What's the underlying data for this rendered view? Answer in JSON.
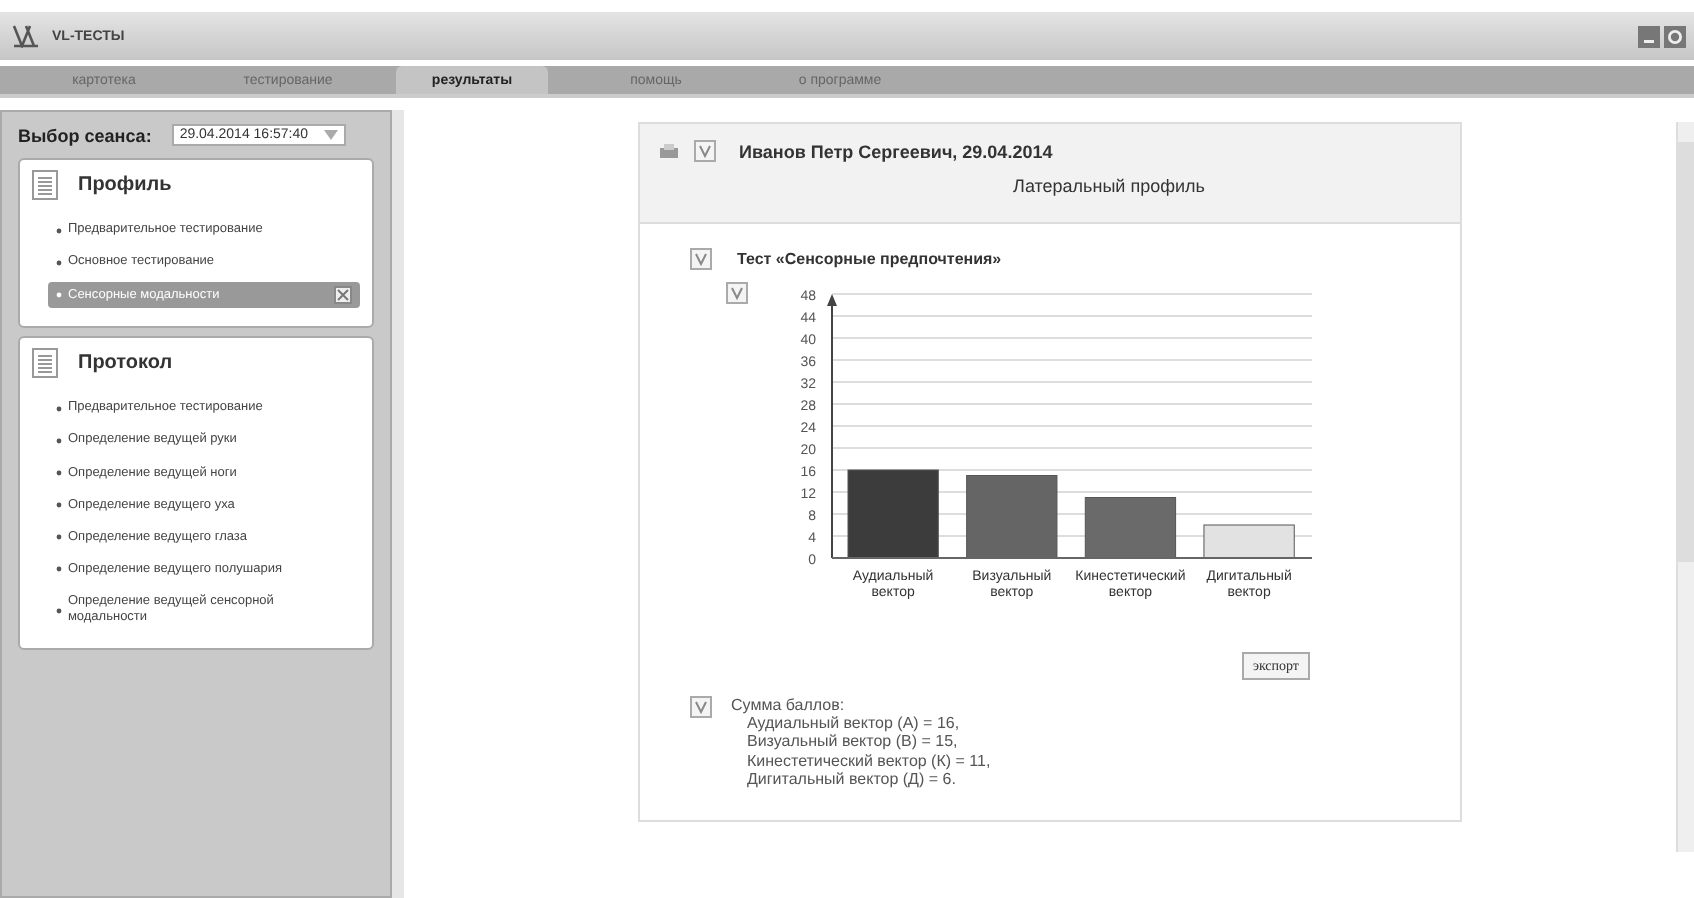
{
  "window": {
    "title": "VL-ТЕСТЫ"
  },
  "tabs": [
    {
      "label": "картотека",
      "selected": false
    },
    {
      "label": "тестирование",
      "selected": false
    },
    {
      "label": "результаты",
      "selected": true
    },
    {
      "label": "помощь",
      "selected": false
    },
    {
      "label": "о программе",
      "selected": false
    }
  ],
  "sidebar": {
    "session_label": "Выбор сеанса:",
    "session_value": "29.04.2014 16:57:40",
    "sections": [
      {
        "title": "Профиль",
        "items": [
          {
            "label": "Предварительное тестирование",
            "selected": false
          },
          {
            "label": "Основное тестирование",
            "selected": false
          },
          {
            "label": "Сенсорные модальности",
            "selected": true
          }
        ]
      },
      {
        "title": "Протокол",
        "items": [
          {
            "label": "Предварительное тестирование",
            "selected": false
          },
          {
            "label": "Определение ведущей руки",
            "selected": false
          },
          {
            "label": "Определение ведущей ноги",
            "selected": false
          },
          {
            "label": "Определение ведущего уха",
            "selected": false
          },
          {
            "label": "Определение ведущего глаза",
            "selected": false
          },
          {
            "label": "Определение ведущего полушария",
            "selected": false
          },
          {
            "label": "Определение ведущей сенсорной модальности",
            "selected": false
          }
        ]
      }
    ]
  },
  "report": {
    "header_checked": true,
    "person": "Иванов  Петр Сергеевич, 29.04.2014",
    "title": "Латеральный профиль",
    "test_checked": true,
    "test_title": "Тест «Сенсорные предпочтения»",
    "chart_checked": true,
    "chart_data": {
      "type": "bar",
      "categories": [
        "Аудиальный вектор",
        "Визуальный вектор",
        "Кинестетический вектор",
        "Дигитальный вектор"
      ],
      "colors": [
        "#3c3c3c",
        "#656565",
        "#6a6a6a",
        "#e2e2e2"
      ],
      "values": [
        16,
        15,
        11,
        6
      ],
      "grid": true,
      "ylim": [
        0,
        48
      ],
      "yticks": [
        0,
        4,
        8,
        12,
        16,
        20,
        24,
        28,
        32,
        36,
        40,
        44,
        48
      ]
    },
    "export_label": "экспорт",
    "sum_checked": true,
    "sum_title": "Сумма баллов:",
    "sum_lines": [
      "Аудиальный вектор (А) = 16,",
      "Визуальный вектор (В) = 15,",
      "Кинестетический вектор (К) = 11,",
      "Дигитальный вектор (Д) = 6."
    ]
  }
}
